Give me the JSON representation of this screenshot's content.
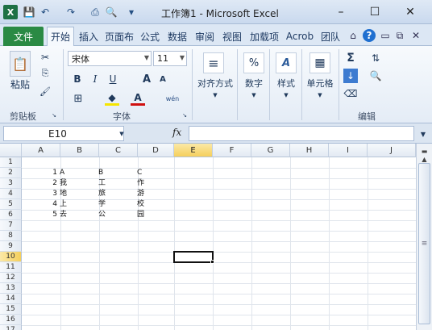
{
  "window": {
    "title": "工作簿1 - Microsoft Excel",
    "controls": [
      "–",
      "☐",
      "✕"
    ]
  },
  "quick_access": [
    "💾",
    "↶",
    "↷",
    "⎙",
    "🔍",
    "▾"
  ],
  "tabs": {
    "file": "文件",
    "items": [
      "开始",
      "插入",
      "页面布",
      "公式",
      "数据",
      "审阅",
      "视图",
      "加载项",
      "Acrob",
      "团队"
    ],
    "active": "开始"
  },
  "ribbon": {
    "clipboard": {
      "paste": "粘贴",
      "label": "剪贴板"
    },
    "font": {
      "name": "宋体",
      "size": "11",
      "label": "字体",
      "bold": "B",
      "italic": "I",
      "underline": "U",
      "grow": "A",
      "shrink": "A",
      "phonetic": "wén"
    },
    "alignment": {
      "label": "对齐方式"
    },
    "number": {
      "label": "数字",
      "symbol": "%"
    },
    "styles": {
      "label": "样式"
    },
    "cells": {
      "label": "单元格"
    },
    "editing": {
      "label": "编辑"
    }
  },
  "formula_bar": {
    "name_box": "E10",
    "fx": "fx",
    "value": ""
  },
  "sheet": {
    "columns": [
      "A",
      "B",
      "C",
      "D",
      "E",
      "F",
      "G",
      "H",
      "I",
      "J"
    ],
    "rows": [
      "1",
      "2",
      "3",
      "4",
      "5",
      "6",
      "7",
      "8",
      "9",
      "10",
      "11",
      "12",
      "13",
      "14",
      "15",
      "16",
      "17"
    ],
    "selected_cell": "E10",
    "cells": {
      "row2": [
        "1",
        "A",
        "B",
        "C"
      ],
      "row3": [
        "2",
        "我",
        "工",
        "作"
      ],
      "row4": [
        "3",
        "地",
        "旅",
        "游"
      ],
      "row5": [
        "4",
        "上",
        "学",
        "校"
      ],
      "row6": [
        "5",
        "去",
        "公",
        "园"
      ]
    }
  }
}
